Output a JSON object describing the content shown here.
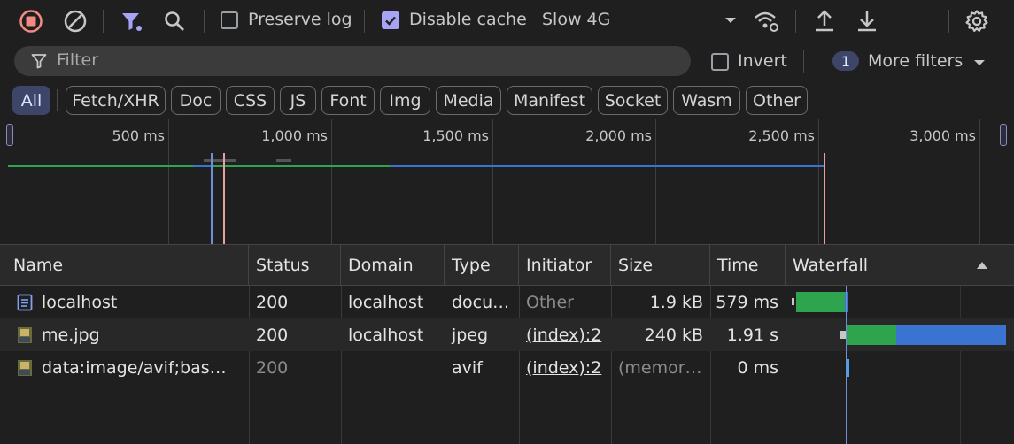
{
  "toolbar": {
    "preserve_log": "Preserve log",
    "disable_cache": "Disable cache",
    "throttling": "Slow 4G"
  },
  "filterbar": {
    "placeholder": "Filter",
    "invert": "Invert",
    "more_filters_count": "1",
    "more_filters": "More filters"
  },
  "chips": [
    "All",
    "Fetch/XHR",
    "Doc",
    "CSS",
    "JS",
    "Font",
    "Img",
    "Media",
    "Manifest",
    "Socket",
    "Wasm",
    "Other"
  ],
  "overview": {
    "ticks": [
      "500 ms",
      "1,000 ms",
      "1,500 ms",
      "2,000 ms",
      "2,500 ms",
      "3,000 ms"
    ]
  },
  "columns": {
    "name": "Name",
    "status": "Status",
    "domain": "Domain",
    "type": "Type",
    "initiator": "Initiator",
    "size": "Size",
    "time": "Time",
    "waterfall": "Waterfall"
  },
  "requests": [
    {
      "name": "localhost",
      "status": "200",
      "domain": "localhost",
      "type": "docu…",
      "initiator": "Other",
      "size": "1.9 kB",
      "time": "579 ms"
    },
    {
      "name": "me.jpg",
      "status": "200",
      "domain": "localhost",
      "type": "jpeg",
      "initiator": "(index):2",
      "size": "240 kB",
      "time": "1.91 s"
    },
    {
      "name": "data:image/avif;bas…",
      "status": "200",
      "domain": "",
      "type": "avif",
      "initiator": "(index):2",
      "size": "(memor…",
      "time": "0 ms"
    }
  ],
  "colors": {
    "accent": "#a8a4f5",
    "record": "#f28b82",
    "waiting": "#2ea44f",
    "download": "#3b73d1"
  }
}
